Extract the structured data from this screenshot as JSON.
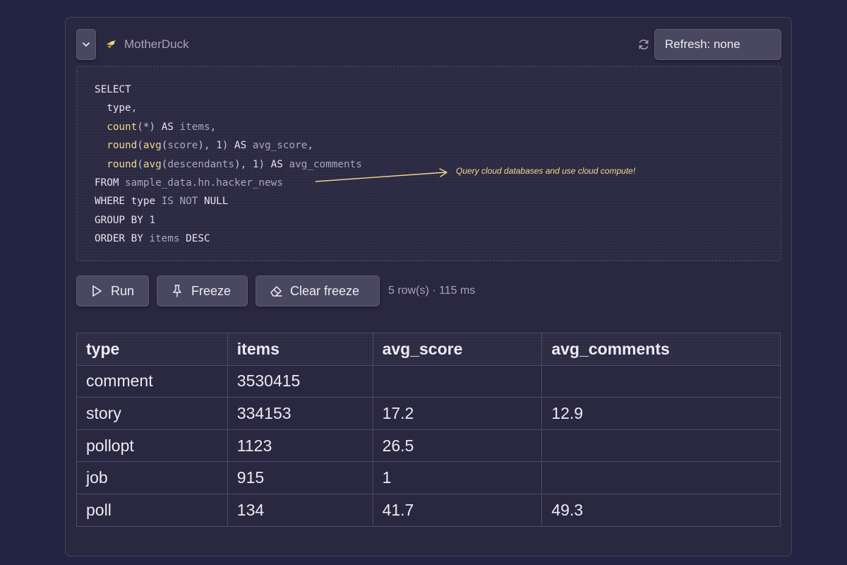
{
  "header": {
    "source_name": "MotherDuck",
    "refresh_label": "Refresh: none"
  },
  "editor": {
    "lines": [
      [
        {
          "t": "SELECT",
          "c": "kw"
        }
      ],
      [
        {
          "t": "  type",
          "c": "kw"
        },
        {
          "t": ",",
          "c": "op"
        }
      ],
      [
        {
          "t": "  count",
          "c": "fn"
        },
        {
          "t": "(*) ",
          "c": "op"
        },
        {
          "t": "AS ",
          "c": "kw"
        },
        {
          "t": "items",
          "c": "id"
        },
        {
          "t": ",",
          "c": "op"
        }
      ],
      [
        {
          "t": "  round",
          "c": "fn"
        },
        {
          "t": "(",
          "c": "op"
        },
        {
          "t": "avg",
          "c": "fn"
        },
        {
          "t": "(",
          "c": "op"
        },
        {
          "t": "score",
          "c": "id"
        },
        {
          "t": "), ",
          "c": "op"
        },
        {
          "t": "1",
          "c": "nm"
        },
        {
          "t": ") ",
          "c": "op"
        },
        {
          "t": "AS ",
          "c": "kw"
        },
        {
          "t": "avg_score",
          "c": "id"
        },
        {
          "t": ",",
          "c": "op"
        }
      ],
      [
        {
          "t": "  round",
          "c": "fn"
        },
        {
          "t": "(",
          "c": "op"
        },
        {
          "t": "avg",
          "c": "fn"
        },
        {
          "t": "(",
          "c": "op"
        },
        {
          "t": "descendants",
          "c": "id"
        },
        {
          "t": "), ",
          "c": "op"
        },
        {
          "t": "1",
          "c": "nm"
        },
        {
          "t": ") ",
          "c": "op"
        },
        {
          "t": "AS ",
          "c": "kw"
        },
        {
          "t": "avg_comments",
          "c": "id"
        }
      ],
      [
        {
          "t": "FROM ",
          "c": "kw"
        },
        {
          "t": "sample_data.hn.hacker_news",
          "c": "id"
        }
      ],
      [
        {
          "t": "WHERE ",
          "c": "kw"
        },
        {
          "t": "type ",
          "c": "kw"
        },
        {
          "t": "IS NOT ",
          "c": "id"
        },
        {
          "t": "NULL",
          "c": "kw"
        }
      ],
      [
        {
          "t": "GROUP BY ",
          "c": "kw"
        },
        {
          "t": "1",
          "c": "nm"
        }
      ],
      [
        {
          "t": "ORDER BY ",
          "c": "kw"
        },
        {
          "t": "items ",
          "c": "id"
        },
        {
          "t": "DESC",
          "c": "kw"
        }
      ]
    ],
    "annotation": "Query cloud databases and use cloud compute!"
  },
  "actions": {
    "run_label": "Run",
    "freeze_label": "Freeze",
    "clear_freeze_label": "Clear freeze",
    "status": "5 row(s) · 115 ms"
  },
  "results": {
    "columns": [
      "type",
      "items",
      "avg_score",
      "avg_comments"
    ],
    "rows": [
      [
        "comment",
        "3530415",
        "",
        ""
      ],
      [
        "story",
        "334153",
        "17.2",
        "12.9"
      ],
      [
        "pollopt",
        "1123",
        "26.5",
        ""
      ],
      [
        "job",
        "915",
        "1",
        ""
      ],
      [
        "poll",
        "134",
        "41.7",
        "49.3"
      ]
    ]
  },
  "colors": {
    "background": "#232342",
    "panel": "#2a2740",
    "button": "#4a4760",
    "function_highlight": "#f2d98a",
    "annotation": "#f2d98a"
  },
  "icons": {
    "collapse": "chevron-down-icon",
    "logo": "motherduck-logo-icon",
    "refresh": "refresh-icon",
    "run": "play-icon",
    "freeze": "pin-icon",
    "clear_freeze": "eraser-icon"
  }
}
